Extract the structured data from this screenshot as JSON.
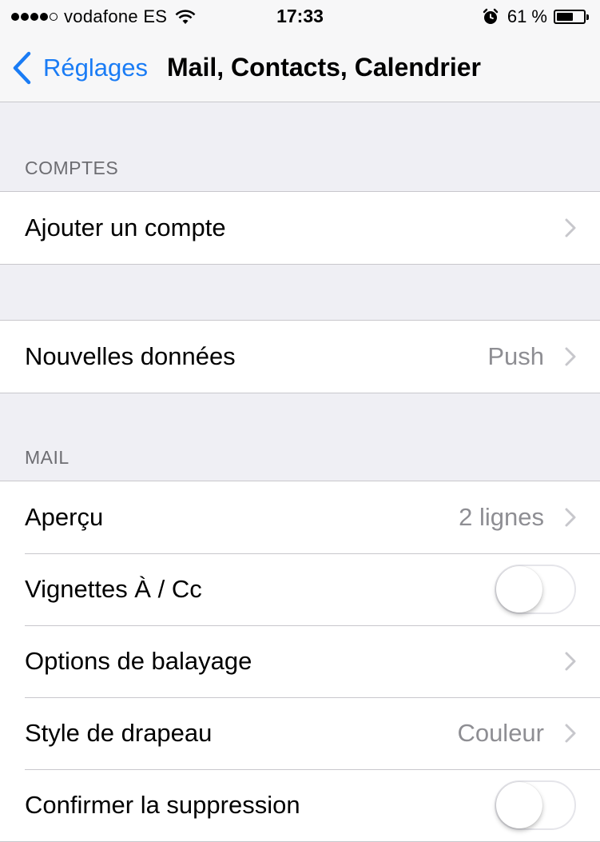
{
  "status_bar": {
    "carrier": "vodafone ES",
    "time": "17:33",
    "battery_percent": "61 %",
    "battery_level": 0.61
  },
  "nav": {
    "back_label": "Réglages",
    "title": "Mail, Contacts, Calendrier"
  },
  "sections": {
    "accounts": {
      "header": "COMPTES",
      "add_account_label": "Ajouter un compte"
    },
    "fetch": {
      "new_data_label": "Nouvelles données",
      "new_data_value": "Push"
    },
    "mail": {
      "header": "MAIL",
      "preview_label": "Aperçu",
      "preview_value": "2 lignes",
      "to_cc_label": "Vignettes À / Cc",
      "to_cc_on": false,
      "swipe_label": "Options de balayage",
      "flag_style_label": "Style de drapeau",
      "flag_style_value": "Couleur",
      "confirm_delete_label": "Confirmer la suppression",
      "confirm_delete_on": false
    }
  },
  "colors": {
    "accent": "#1a7cf5",
    "background": "#efeff4",
    "secondary_text": "#8e8e93"
  }
}
